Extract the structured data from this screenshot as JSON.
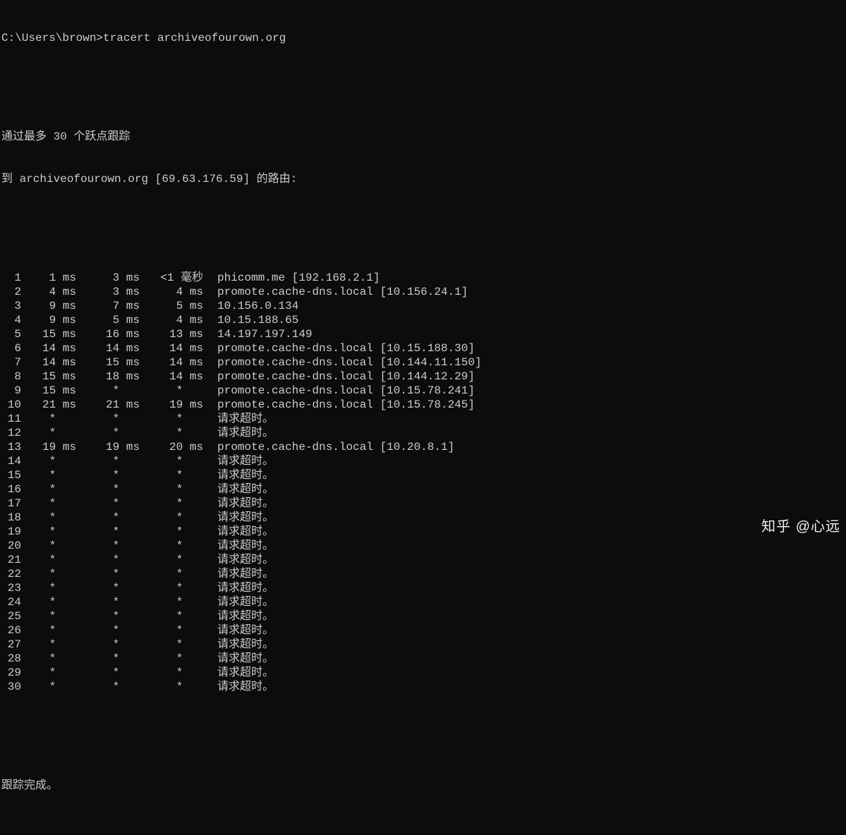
{
  "prompt": "C:\\Users\\brown>",
  "command": "tracert archiveofourown.org",
  "header_line1": "通过最多 30 个跃点跟踪",
  "header_line2": "到 archiveofourown.org [69.63.176.59] 的路由:",
  "hops": [
    {
      "n": "1",
      "t1": "1 ms",
      "t2": "3 ms",
      "t3": "<1 毫秒",
      "dest": "phicomm.me [192.168.2.1]"
    },
    {
      "n": "2",
      "t1": "4 ms",
      "t2": "3 ms",
      "t3": "4 ms",
      "dest": "promote.cache-dns.local [10.156.24.1]"
    },
    {
      "n": "3",
      "t1": "9 ms",
      "t2": "7 ms",
      "t3": "5 ms",
      "dest": "10.156.0.134"
    },
    {
      "n": "4",
      "t1": "9 ms",
      "t2": "5 ms",
      "t3": "4 ms",
      "dest": "10.15.188.65"
    },
    {
      "n": "5",
      "t1": "15 ms",
      "t2": "16 ms",
      "t3": "13 ms",
      "dest": "14.197.197.149"
    },
    {
      "n": "6",
      "t1": "14 ms",
      "t2": "14 ms",
      "t3": "14 ms",
      "dest": "promote.cache-dns.local [10.15.188.30]"
    },
    {
      "n": "7",
      "t1": "14 ms",
      "t2": "15 ms",
      "t3": "14 ms",
      "dest": "promote.cache-dns.local [10.144.11.150]"
    },
    {
      "n": "8",
      "t1": "15 ms",
      "t2": "18 ms",
      "t3": "14 ms",
      "dest": "promote.cache-dns.local [10.144.12.29]"
    },
    {
      "n": "9",
      "t1": "15 ms",
      "t2": "*   ",
      "t3": "*   ",
      "dest": "promote.cache-dns.local [10.15.78.241]"
    },
    {
      "n": "10",
      "t1": "21 ms",
      "t2": "21 ms",
      "t3": "19 ms",
      "dest": "promote.cache-dns.local [10.15.78.245]"
    },
    {
      "n": "11",
      "t1": "*   ",
      "t2": "*   ",
      "t3": "*   ",
      "dest": "请求超时。"
    },
    {
      "n": "12",
      "t1": "*   ",
      "t2": "*   ",
      "t3": "*   ",
      "dest": "请求超时。"
    },
    {
      "n": "13",
      "t1": "19 ms",
      "t2": "19 ms",
      "t3": "20 ms",
      "dest": "promote.cache-dns.local [10.20.8.1]"
    },
    {
      "n": "14",
      "t1": "*   ",
      "t2": "*   ",
      "t3": "*   ",
      "dest": "请求超时。"
    },
    {
      "n": "15",
      "t1": "*   ",
      "t2": "*   ",
      "t3": "*   ",
      "dest": "请求超时。"
    },
    {
      "n": "16",
      "t1": "*   ",
      "t2": "*   ",
      "t3": "*   ",
      "dest": "请求超时。"
    },
    {
      "n": "17",
      "t1": "*   ",
      "t2": "*   ",
      "t3": "*   ",
      "dest": "请求超时。"
    },
    {
      "n": "18",
      "t1": "*   ",
      "t2": "*   ",
      "t3": "*   ",
      "dest": "请求超时。"
    },
    {
      "n": "19",
      "t1": "*   ",
      "t2": "*   ",
      "t3": "*   ",
      "dest": "请求超时。"
    },
    {
      "n": "20",
      "t1": "*   ",
      "t2": "*   ",
      "t3": "*   ",
      "dest": "请求超时。"
    },
    {
      "n": "21",
      "t1": "*   ",
      "t2": "*   ",
      "t3": "*   ",
      "dest": "请求超时。"
    },
    {
      "n": "22",
      "t1": "*   ",
      "t2": "*   ",
      "t3": "*   ",
      "dest": "请求超时。"
    },
    {
      "n": "23",
      "t1": "*   ",
      "t2": "*   ",
      "t3": "*   ",
      "dest": "请求超时。"
    },
    {
      "n": "24",
      "t1": "*   ",
      "t2": "*   ",
      "t3": "*   ",
      "dest": "请求超时。"
    },
    {
      "n": "25",
      "t1": "*   ",
      "t2": "*   ",
      "t3": "*   ",
      "dest": "请求超时。"
    },
    {
      "n": "26",
      "t1": "*   ",
      "t2": "*   ",
      "t3": "*   ",
      "dest": "请求超时。"
    },
    {
      "n": "27",
      "t1": "*   ",
      "t2": "*   ",
      "t3": "*   ",
      "dest": "请求超时。"
    },
    {
      "n": "28",
      "t1": "*   ",
      "t2": "*   ",
      "t3": "*   ",
      "dest": "请求超时。"
    },
    {
      "n": "29",
      "t1": "*   ",
      "t2": "*   ",
      "t3": "*   ",
      "dest": "请求超时。"
    },
    {
      "n": "30",
      "t1": "*   ",
      "t2": "*   ",
      "t3": "*   ",
      "dest": "请求超时。"
    }
  ],
  "footer": "跟踪完成。",
  "watermark": "知乎 @心远"
}
